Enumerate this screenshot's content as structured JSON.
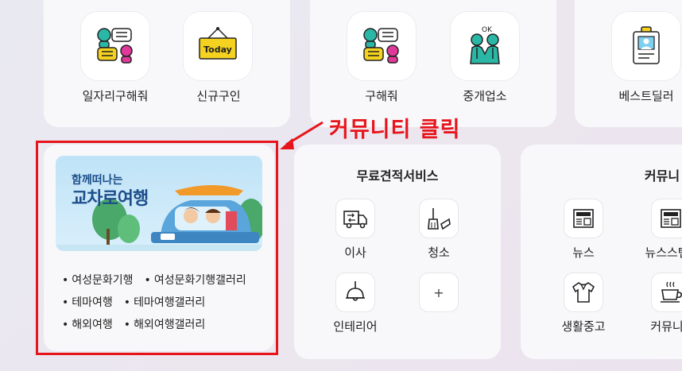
{
  "top_cards": {
    "card1": [
      {
        "label": "일자리구해줘",
        "icon": "chat-people-icon"
      },
      {
        "label": "신규구인",
        "icon": "today-sign-icon",
        "badge": "Today"
      }
    ],
    "card2": [
      {
        "label": "구해줘",
        "icon": "chat-people-icon"
      },
      {
        "label": "중개업소",
        "icon": "handshake-ok-icon",
        "badge": "OK"
      }
    ],
    "card3": [
      {
        "label": "베스트딜러",
        "icon": "id-badge-icon"
      }
    ]
  },
  "annotation": "커뮤니티 클릭",
  "travel_card": {
    "banner_small": "함께떠나는",
    "banner_big": "교차로여행",
    "links": [
      [
        "여성문화기행",
        "여성문화기행갤러리"
      ],
      [
        "테마여행",
        "테마여행갤러리"
      ],
      [
        "해외여행",
        "해외여행갤러리"
      ]
    ]
  },
  "free_service": {
    "title": "무료견적서비스",
    "items": [
      {
        "label": "이사",
        "icon": "moving-truck-icon"
      },
      {
        "label": "청소",
        "icon": "broom-icon"
      },
      {
        "label": "인테리어",
        "icon": "pendant-lamp-icon"
      },
      {
        "label": "",
        "icon": "plus-icon",
        "symbol": "+"
      }
    ]
  },
  "community": {
    "title": "커뮤니",
    "items": [
      {
        "label": "뉴스",
        "icon": "newspaper-icon"
      },
      {
        "label": "뉴스스탠",
        "icon": "newspaper-icon"
      },
      {
        "label": "생활중고",
        "icon": "shirt-icon"
      },
      {
        "label": "커뮤니",
        "icon": "coffee-cup-icon"
      }
    ]
  },
  "colors": {
    "annotation_red": "#e8141b",
    "card_bg": "#f8f8fa"
  }
}
